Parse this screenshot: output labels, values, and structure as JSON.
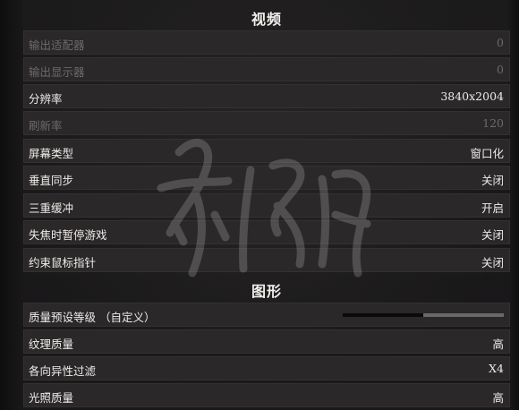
{
  "sections": [
    {
      "title": "视频",
      "rows": [
        {
          "label": "输出适配器",
          "value": "0",
          "disabled": true
        },
        {
          "label": "输出显示器",
          "value": "0",
          "disabled": true
        },
        {
          "label": "分辨率",
          "value": "3840x2004",
          "disabled": false
        },
        {
          "label": "刷新率",
          "value": "120",
          "disabled": true
        },
        {
          "label": "屏幕类型",
          "value": "窗口化",
          "disabled": false
        },
        {
          "label": "垂直同步",
          "value": "关闭",
          "disabled": false
        },
        {
          "label": "三重缓冲",
          "value": "开启",
          "disabled": false
        },
        {
          "label": "失焦时暂停游戏",
          "value": "关闭",
          "disabled": false
        },
        {
          "label": "约束鼠标指针",
          "value": "关闭",
          "disabled": false
        }
      ]
    },
    {
      "title": "图形",
      "rows": [
        {
          "label": "质量预设等级  （自定义）",
          "slider_fraction": 0.5
        },
        {
          "label": "纹理质量",
          "value": "高"
        },
        {
          "label": "各向异性过滤",
          "value": "X4"
        },
        {
          "label": "光照质量",
          "value": "高"
        }
      ]
    }
  ],
  "colors": {
    "background": "#1b1a1b",
    "row_background": "#2b292a",
    "text": "#efebe8",
    "text_disabled": "#6e6a68",
    "slider_fill": "#0a0a0a",
    "slider_track": "#6b6866"
  }
}
